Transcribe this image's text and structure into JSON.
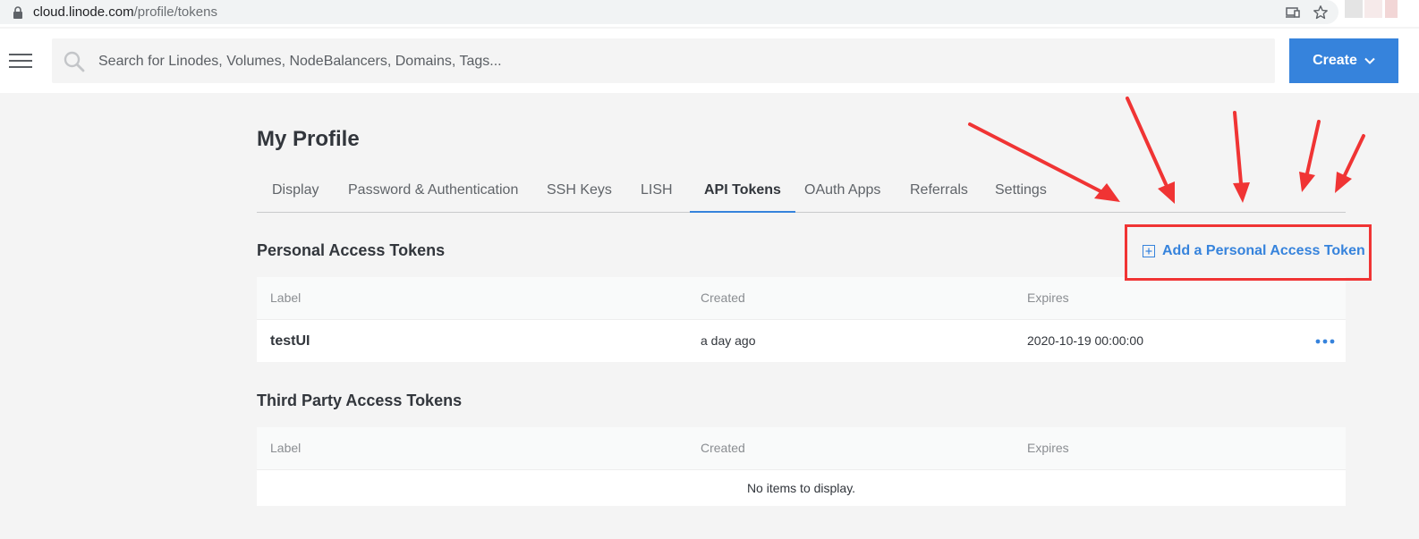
{
  "browser": {
    "url_host": "cloud.linode.com",
    "url_path": "/profile/tokens",
    "icons": [
      "lock-icon",
      "cast-icon",
      "star-icon"
    ]
  },
  "topbar": {
    "menu_icon": "hamburger-icon",
    "search": {
      "placeholder": "Search for Linodes, Volumes, NodeBalancers, Domains, Tags...",
      "value": ""
    },
    "create_label": "Create"
  },
  "page": {
    "title": "My Profile",
    "tabs": [
      {
        "label": "Display",
        "active": false
      },
      {
        "label": "Password & Authentication",
        "active": false
      },
      {
        "label": "SSH Keys",
        "active": false
      },
      {
        "label": "LISH",
        "active": false
      },
      {
        "label": "API Tokens",
        "active": true
      },
      {
        "label": "OAuth Apps",
        "active": false
      },
      {
        "label": "Referrals",
        "active": false
      },
      {
        "label": "Settings",
        "active": false
      }
    ]
  },
  "personal": {
    "title": "Personal Access Tokens",
    "add_label": "Add a Personal Access Token",
    "columns": [
      "Label",
      "Created",
      "Expires"
    ],
    "rows": [
      {
        "label": "testUI",
        "created": "a day ago",
        "expires": "2020-10-19 00:00:00"
      }
    ]
  },
  "third_party": {
    "title": "Third Party Access Tokens",
    "columns": [
      "Label",
      "Created",
      "Expires"
    ],
    "empty_text": "No items to display."
  },
  "colors": {
    "accent": "#3683dc",
    "annotation": "#f03434",
    "background": "#f4f4f4"
  }
}
